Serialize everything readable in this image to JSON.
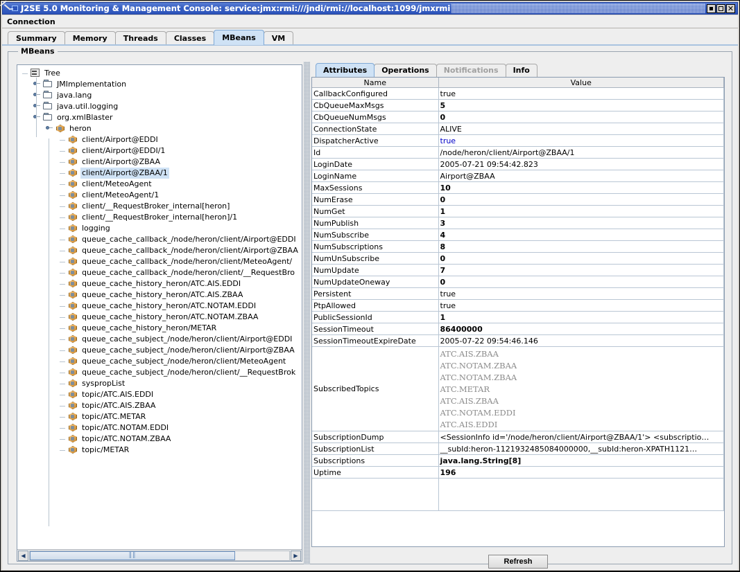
{
  "window": {
    "title": "J2SE 5.0 Monitoring & Management Console: service:jmx:rmi:///jndi/rmi://localhost:1099/jmxrmi",
    "minimize_label": "_",
    "maximize_label": "□",
    "close_label": "×"
  },
  "menubar": {
    "items": [
      {
        "label": "Connection"
      }
    ]
  },
  "tabs": [
    {
      "label": "Summary",
      "selected": false
    },
    {
      "label": "Memory",
      "selected": false
    },
    {
      "label": "Threads",
      "selected": false
    },
    {
      "label": "Classes",
      "selected": false
    },
    {
      "label": "MBeans",
      "selected": true
    },
    {
      "label": "VM",
      "selected": false
    }
  ],
  "panel": {
    "title": "MBeans"
  },
  "tree": {
    "root": "Tree",
    "nodes": [
      {
        "label": "JMImplementation",
        "depth": 1,
        "icon": "folder-icon",
        "expandable": true,
        "expanded": false,
        "selected": false
      },
      {
        "label": "java.lang",
        "depth": 1,
        "icon": "folder-icon",
        "expandable": true,
        "expanded": false,
        "selected": false
      },
      {
        "label": "java.util.logging",
        "depth": 1,
        "icon": "folder-icon",
        "expandable": true,
        "expanded": false,
        "selected": false
      },
      {
        "label": "org.xmlBlaster",
        "depth": 1,
        "icon": "folder-icon",
        "expandable": true,
        "expanded": true,
        "selected": false
      },
      {
        "label": "heron",
        "depth": 2,
        "icon": "mbean-icon",
        "expandable": true,
        "expanded": true,
        "selected": false
      },
      {
        "label": "client/Airport@EDDI",
        "depth": 3,
        "icon": "mbean-icon",
        "expandable": false,
        "expanded": false,
        "selected": false
      },
      {
        "label": "client/Airport@EDDI/1",
        "depth": 3,
        "icon": "mbean-icon",
        "expandable": false,
        "expanded": false,
        "selected": false
      },
      {
        "label": "client/Airport@ZBAA",
        "depth": 3,
        "icon": "mbean-icon",
        "expandable": false,
        "expanded": false,
        "selected": false
      },
      {
        "label": "client/Airport@ZBAA/1",
        "depth": 3,
        "icon": "mbean-icon",
        "expandable": false,
        "expanded": false,
        "selected": true
      },
      {
        "label": "client/MeteoAgent",
        "depth": 3,
        "icon": "mbean-icon",
        "expandable": false,
        "expanded": false,
        "selected": false
      },
      {
        "label": "client/MeteoAgent/1",
        "depth": 3,
        "icon": "mbean-icon",
        "expandable": false,
        "expanded": false,
        "selected": false
      },
      {
        "label": "client/__RequestBroker_internal[heron]",
        "depth": 3,
        "icon": "mbean-icon",
        "expandable": false,
        "expanded": false,
        "selected": false
      },
      {
        "label": "client/__RequestBroker_internal[heron]/1",
        "depth": 3,
        "icon": "mbean-icon",
        "expandable": false,
        "expanded": false,
        "selected": false
      },
      {
        "label": "logging",
        "depth": 3,
        "icon": "mbean-icon",
        "expandable": false,
        "expanded": false,
        "selected": false
      },
      {
        "label": "queue_cache_callback_/node/heron/client/Airport@EDDI",
        "depth": 3,
        "icon": "mbean-icon",
        "expandable": false,
        "expanded": false,
        "selected": false
      },
      {
        "label": "queue_cache_callback_/node/heron/client/Airport@ZBAA",
        "depth": 3,
        "icon": "mbean-icon",
        "expandable": false,
        "expanded": false,
        "selected": false
      },
      {
        "label": "queue_cache_callback_/node/heron/client/MeteoAgent/",
        "depth": 3,
        "icon": "mbean-icon",
        "expandable": false,
        "expanded": false,
        "selected": false
      },
      {
        "label": "queue_cache_callback_/node/heron/client/__RequestBro",
        "depth": 3,
        "icon": "mbean-icon",
        "expandable": false,
        "expanded": false,
        "selected": false
      },
      {
        "label": "queue_cache_history_heron/ATC.AIS.EDDI",
        "depth": 3,
        "icon": "mbean-icon",
        "expandable": false,
        "expanded": false,
        "selected": false
      },
      {
        "label": "queue_cache_history_heron/ATC.AIS.ZBAA",
        "depth": 3,
        "icon": "mbean-icon",
        "expandable": false,
        "expanded": false,
        "selected": false
      },
      {
        "label": "queue_cache_history_heron/ATC.NOTAM.EDDI",
        "depth": 3,
        "icon": "mbean-icon",
        "expandable": false,
        "expanded": false,
        "selected": false
      },
      {
        "label": "queue_cache_history_heron/ATC.NOTAM.ZBAA",
        "depth": 3,
        "icon": "mbean-icon",
        "expandable": false,
        "expanded": false,
        "selected": false
      },
      {
        "label": "queue_cache_history_heron/METAR",
        "depth": 3,
        "icon": "mbean-icon",
        "expandable": false,
        "expanded": false,
        "selected": false
      },
      {
        "label": "queue_cache_subject_/node/heron/client/Airport@EDDI",
        "depth": 3,
        "icon": "mbean-icon",
        "expandable": false,
        "expanded": false,
        "selected": false
      },
      {
        "label": "queue_cache_subject_/node/heron/client/Airport@ZBAA",
        "depth": 3,
        "icon": "mbean-icon",
        "expandable": false,
        "expanded": false,
        "selected": false
      },
      {
        "label": "queue_cache_subject_/node/heron/client/MeteoAgent",
        "depth": 3,
        "icon": "mbean-icon",
        "expandable": false,
        "expanded": false,
        "selected": false
      },
      {
        "label": "queue_cache_subject_/node/heron/client/__RequestBrok",
        "depth": 3,
        "icon": "mbean-icon",
        "expandable": false,
        "expanded": false,
        "selected": false
      },
      {
        "label": "syspropList",
        "depth": 3,
        "icon": "mbean-icon",
        "expandable": false,
        "expanded": false,
        "selected": false
      },
      {
        "label": "topic/ATC.AIS.EDDI",
        "depth": 3,
        "icon": "mbean-icon",
        "expandable": false,
        "expanded": false,
        "selected": false
      },
      {
        "label": "topic/ATC.AIS.ZBAA",
        "depth": 3,
        "icon": "mbean-icon",
        "expandable": false,
        "expanded": false,
        "selected": false
      },
      {
        "label": "topic/ATC.METAR",
        "depth": 3,
        "icon": "mbean-icon",
        "expandable": false,
        "expanded": false,
        "selected": false
      },
      {
        "label": "topic/ATC.NOTAM.EDDI",
        "depth": 3,
        "icon": "mbean-icon",
        "expandable": false,
        "expanded": false,
        "selected": false
      },
      {
        "label": "topic/ATC.NOTAM.ZBAA",
        "depth": 3,
        "icon": "mbean-icon",
        "expandable": false,
        "expanded": false,
        "selected": false
      },
      {
        "label": "topic/METAR",
        "depth": 3,
        "icon": "mbean-icon",
        "expandable": false,
        "expanded": false,
        "selected": false
      }
    ],
    "scrollbar": {
      "left_arrow": "◀",
      "right_arrow": "▶",
      "grip": "‖‖"
    }
  },
  "detail": {
    "tabs": [
      {
        "label": "Attributes",
        "selected": true,
        "disabled": false
      },
      {
        "label": "Operations",
        "selected": false,
        "disabled": false
      },
      {
        "label": "Notifications",
        "selected": false,
        "disabled": true
      },
      {
        "label": "Info",
        "selected": false,
        "disabled": false
      }
    ],
    "columns": [
      "Name",
      "Value"
    ],
    "rows": [
      {
        "name": "CallbackConfigured",
        "value": "true",
        "bold": false
      },
      {
        "name": "CbQueueMaxMsgs",
        "value": "5",
        "bold": true
      },
      {
        "name": "CbQueueNumMsgs",
        "value": "0",
        "bold": true
      },
      {
        "name": "ConnectionState",
        "value": "ALIVE",
        "bold": false
      },
      {
        "name": "DispatcherActive",
        "value": "true",
        "bold": false,
        "color": "blue"
      },
      {
        "name": "Id",
        "value": "/node/heron/client/Airport@ZBAA/1",
        "bold": false
      },
      {
        "name": "LoginDate",
        "value": "2005-07-21 09:54:42.823",
        "bold": false
      },
      {
        "name": "LoginName",
        "value": "Airport@ZBAA",
        "bold": false
      },
      {
        "name": "MaxSessions",
        "value": "10",
        "bold": true
      },
      {
        "name": "NumErase",
        "value": "0",
        "bold": true
      },
      {
        "name": "NumGet",
        "value": "1",
        "bold": true
      },
      {
        "name": "NumPublish",
        "value": "3",
        "bold": true
      },
      {
        "name": "NumSubscribe",
        "value": "4",
        "bold": true
      },
      {
        "name": "NumSubscriptions",
        "value": "8",
        "bold": true
      },
      {
        "name": "NumUnSubscribe",
        "value": "0",
        "bold": true
      },
      {
        "name": "NumUpdate",
        "value": "7",
        "bold": true
      },
      {
        "name": "NumUpdateOneway",
        "value": "0",
        "bold": true
      },
      {
        "name": "Persistent",
        "value": "true",
        "bold": false
      },
      {
        "name": "PtpAllowed",
        "value": "true",
        "bold": false
      },
      {
        "name": "PublicSessionId",
        "value": "1",
        "bold": true
      },
      {
        "name": "SessionTimeout",
        "value": "86400000",
        "bold": true
      },
      {
        "name": "SessionTimeoutExpireDate",
        "value": "2005-07-22 09:54:46.146",
        "bold": false
      }
    ],
    "subscribed_topics": {
      "name": "SubscribedTopics",
      "values": [
        "ATC.AIS.ZBAA",
        "ATC.NOTAM.ZBAA",
        "ATC.NOTAM.ZBAA",
        "ATC.METAR",
        "ATC.AIS.ZBAA",
        "ATC.NOTAM.EDDI",
        "ATC.AIS.EDDI"
      ]
    },
    "tail_rows": [
      {
        "name": "SubscriptionDump",
        "value": "<SessionInfo id='/node/heron/client/Airport@ZBAA/1'>  <subscriptio…",
        "bold": false
      },
      {
        "name": "SubscriptionList",
        "value": "__subId:heron-1121932485084000000,__subId:heron-XPATH1121…",
        "bold": false
      },
      {
        "name": "Subscriptions",
        "value": "java.lang.String[8]",
        "bold": true
      },
      {
        "name": "Uptime",
        "value": "196",
        "bold": true
      }
    ],
    "refresh_label": "Refresh"
  }
}
